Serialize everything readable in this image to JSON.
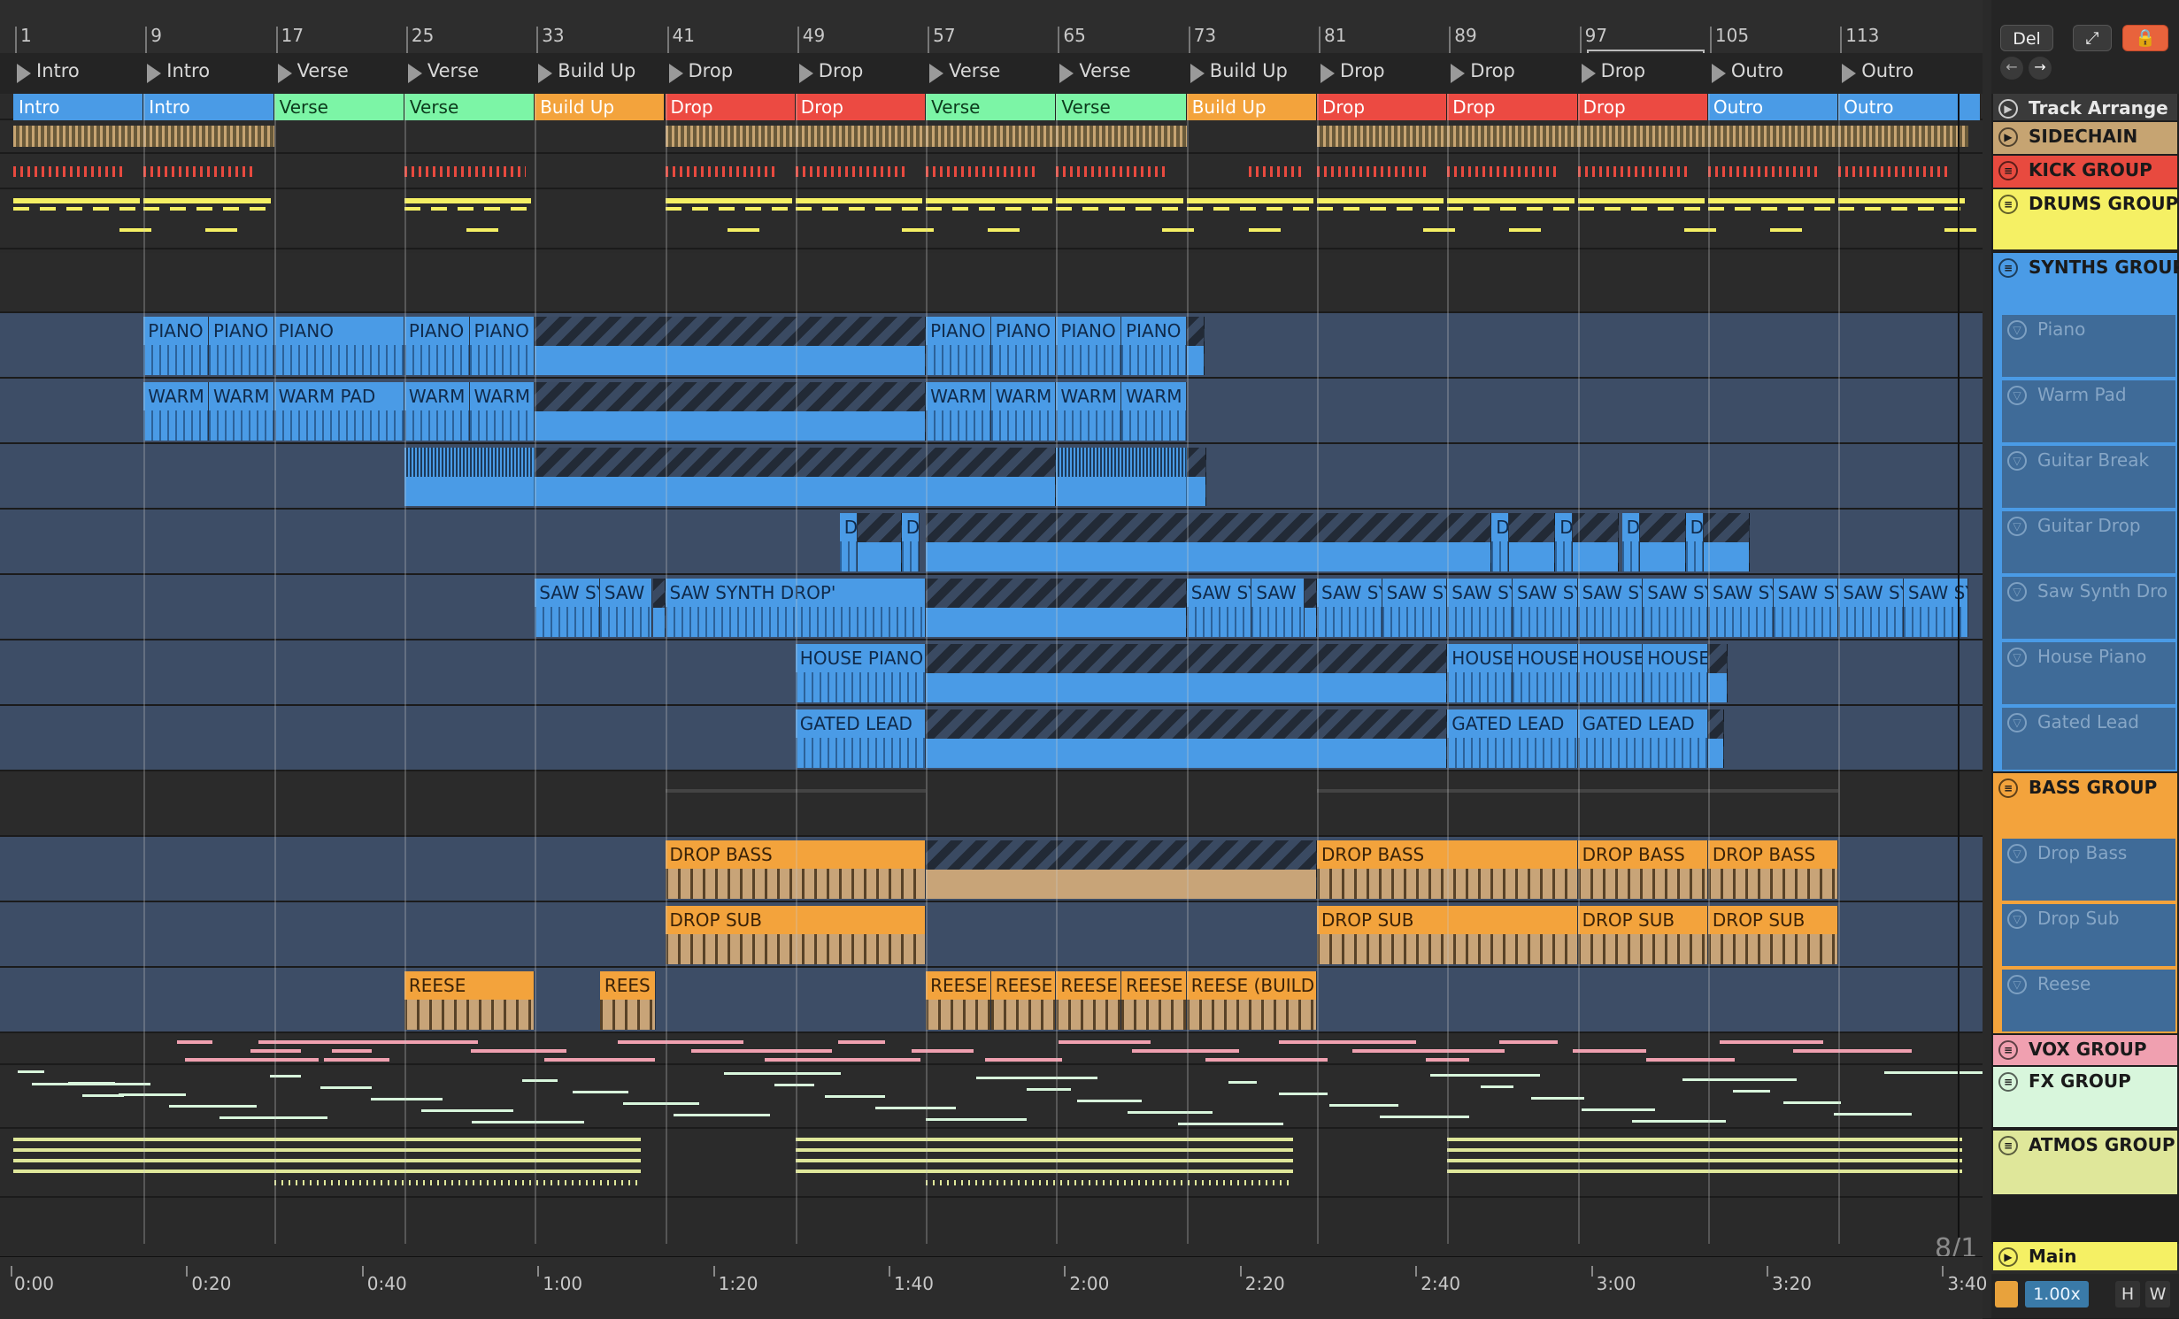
{
  "ruler": {
    "bars": [
      "1",
      "9",
      "17",
      "25",
      "33",
      "41",
      "49",
      "57",
      "65",
      "73",
      "81",
      "89",
      "97",
      "105",
      "113"
    ]
  },
  "locators": [
    "Intro",
    "Intro",
    "Verse",
    "Verse",
    "Build Up",
    "Drop",
    "Drop",
    "Verse",
    "Verse",
    "Build Up",
    "Drop",
    "Drop",
    "Drop",
    "Outro",
    "Outro"
  ],
  "sections": [
    "Intro",
    "Intro",
    "Verse",
    "Verse",
    "Build Up",
    "Drop",
    "Drop",
    "Verse",
    "Verse",
    "Build Up",
    "Drop",
    "Drop",
    "Drop",
    "Outro",
    "Outro"
  ],
  "colors": {
    "intro": "#4a9be6",
    "verse": "#7cf5a6",
    "buildup": "#f3a33c",
    "drop": "#ec4a42",
    "outro": "#4a9be6",
    "sidechain": "#c6a472",
    "kick": "#e84a3f",
    "drums": "#f5f064",
    "synths": "#4a9be6",
    "bass": "#f3a33c",
    "vox": "#f0a0b0",
    "fx": "#d8f6dc",
    "atmos": "#dfe79a",
    "main": "#f5f064"
  },
  "clips": {
    "piano": [
      "PIANO",
      "PIANO",
      "PIANO",
      "PIANO",
      "PIANO",
      "PIANO",
      "PIANO",
      "PIANO",
      "PIANO"
    ],
    "warm": [
      "WARM",
      "WARM",
      "WARM PAD",
      "WARM",
      "WARM",
      "WARM",
      "WARM",
      "WARM",
      "WARM"
    ],
    "guitar_drop": [
      "D",
      "D",
      "D",
      "D",
      "D",
      "D"
    ],
    "saw": [
      "SAW SY",
      "SAW",
      "SAW SYNTH DROP'",
      "SAW SY",
      "SAW",
      "SAW SY",
      "SAW SY",
      "SAW SY",
      "SAW SY",
      "SAW SY",
      "SAW SY",
      "SAW SY",
      "SAW SY",
      "SAW SY",
      "SAW SY"
    ],
    "house": [
      "HOUSE PIANO",
      "HOUSE",
      "HOUSE",
      "HOUSE",
      "HOUSE"
    ],
    "gated": [
      "GATED LEAD",
      "GATED LEAD",
      "GATED LEAD"
    ],
    "drop_bass": [
      "DROP BASS",
      "DROP BASS",
      "DROP BASS",
      "DROP BASS"
    ],
    "drop_sub": [
      "DROP SUB",
      "DROP SUB",
      "DROP SUB",
      "DROP SUB"
    ],
    "reese": [
      "REESE",
      "REES",
      "REESE",
      "REESE",
      "REESE",
      "REESE",
      "REESE (BUILD U"
    ]
  },
  "tracks": {
    "arrange": "Track Arrange",
    "sidechain": "SIDECHAIN",
    "kick": "KICK GROUP",
    "drums": "DRUMS GROUP",
    "synths": "SYNTHS GROUP",
    "piano": "Piano",
    "warm_pad": "Warm Pad",
    "guitar_break": "Guitar Break",
    "guitar_drop": "Guitar Drop",
    "saw_synth": "Saw Synth Dro",
    "house_piano": "House Piano",
    "gated_lead": "Gated Lead",
    "bass": "BASS GROUP",
    "drop_bass": "Drop Bass",
    "drop_sub": "Drop Sub",
    "reese": "Reese",
    "vox": "VOX GROUP",
    "fx": "FX GROUP",
    "atmos": "ATMOS GROUP",
    "main": "Main"
  },
  "controls": {
    "del": "Del",
    "zoom": "1.00x",
    "h": "H",
    "w": "W",
    "signature": "8/1"
  },
  "time": [
    "0:00",
    "0:20",
    "0:40",
    "1:00",
    "1:20",
    "1:40",
    "2:00",
    "2:20",
    "2:40",
    "3:00",
    "3:20",
    "3:40"
  ]
}
